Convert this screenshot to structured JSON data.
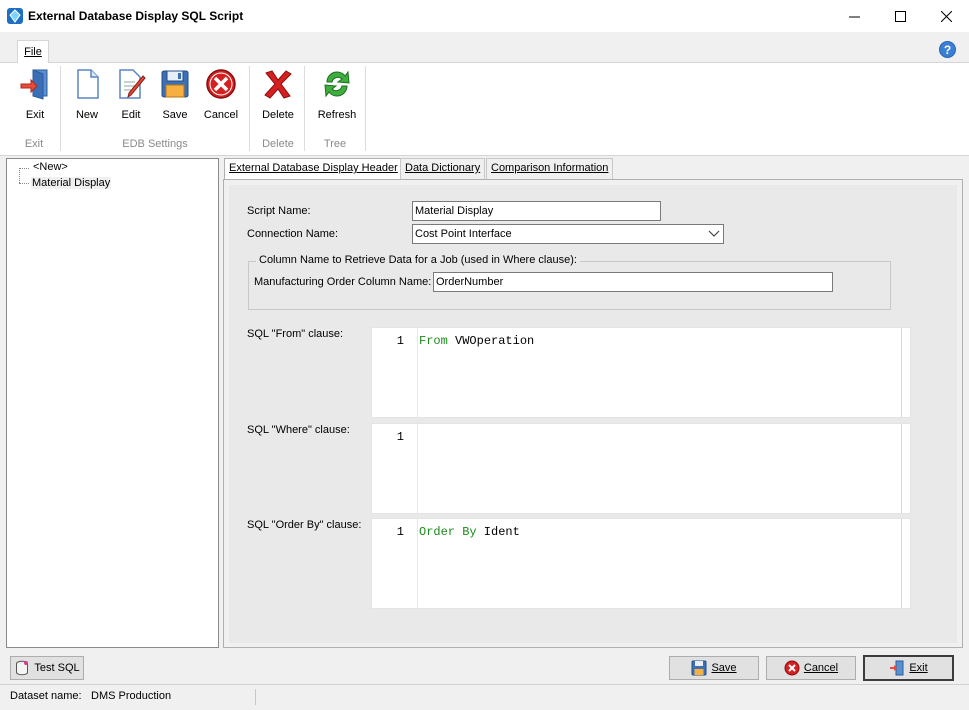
{
  "window": {
    "title": "External Database Display SQL Script"
  },
  "ribbon": {
    "tab_label": "File",
    "buttons": {
      "exit": "Exit",
      "new": "New",
      "edit": "Edit",
      "save": "Save",
      "cancel": "Cancel",
      "delete": "Delete",
      "refresh": "Refresh"
    },
    "groups": {
      "exit": "Exit",
      "edb_settings": "EDB Settings",
      "delete": "Delete",
      "tree": "Tree"
    }
  },
  "tree": {
    "items": [
      "<New>",
      "Material Display"
    ],
    "selected": "Material Display"
  },
  "tabs": [
    "External Database Display Header",
    "Data Dictionary",
    "Comparison Information"
  ],
  "form": {
    "script_name_label": "Script Name:",
    "script_name_value": "Material Display",
    "connection_name_label": "Connection Name:",
    "connection_name_value": "Cost Point Interface",
    "groupbox_title": "Column Name to Retrieve Data for a Job (used in Where clause):",
    "mfg_order_label": "Manufacturing Order Column Name:",
    "mfg_order_value": "OrderNumber",
    "sql_from_label": "SQL \"From\" clause:",
    "sql_from_line": "1",
    "sql_from_keyword": "From",
    "sql_from_rest": " VWOperation",
    "sql_where_label": "SQL \"Where\" clause:",
    "sql_where_line": "1",
    "sql_orderby_label": "SQL \"Order By\" clause:",
    "sql_orderby_line": "1",
    "sql_orderby_keyword": "Order By",
    "sql_orderby_rest": " Ident"
  },
  "bottom": {
    "test_sql": "Test SQL",
    "save": "Save",
    "cancel": "Cancel",
    "exit": "Exit"
  },
  "status": {
    "label": "Dataset name:",
    "value": "DMS Production"
  },
  "colors": {
    "sql_keyword": "#1a8a1a",
    "help_icon": "#3b7fd4",
    "cancel_red": "#d42020"
  }
}
